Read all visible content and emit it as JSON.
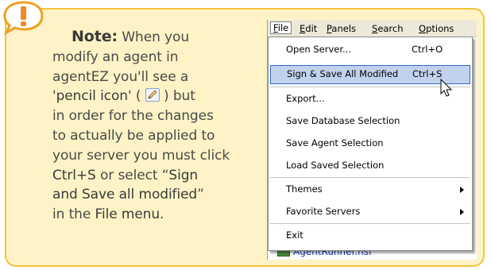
{
  "note": {
    "label": "Note:",
    "line1_rest": " When you",
    "line2": "modify an agent in",
    "line3": "agentEZ you'll see a",
    "line4_pre": "'",
    "pencil_phrase": "pencil icon",
    "line4_mid": "' (",
    "line4_post": ") but",
    "line5": "in order for the changes",
    "line6": "to actually be applied to",
    "line7": "your server you must click",
    "shortcut": "Ctrl+S",
    "line8_mid": " or select “",
    "sign_phrase1": "Sign",
    "sign_phrase2": "and Save all modified",
    "line9_post": "”",
    "line10_pre": "in the ",
    "file_menu": "File menu",
    "line10_post": "."
  },
  "app": {
    "menubar": [
      {
        "label": "File",
        "active": true
      },
      {
        "label": "Edit",
        "active": false
      },
      {
        "label": "Panels",
        "active": false
      },
      {
        "label": "Search",
        "active": false
      },
      {
        "label": "Options",
        "active": false
      }
    ],
    "file_menu_items": [
      {
        "label": "Open Server...",
        "shortcut": "Ctrl+O"
      },
      {
        "label": "Sign & Save All Modified",
        "shortcut": "Ctrl+S",
        "highlighted": true
      },
      {
        "label": "Export..."
      },
      {
        "label": "Save Database Selection"
      },
      {
        "label": "Save Agent Selection"
      },
      {
        "label": "Load Saved Selection"
      },
      {
        "label": "Themes",
        "submenu": true
      },
      {
        "label": "Favorite Servers",
        "submenu": true
      },
      {
        "label": "Exit"
      }
    ],
    "background_row": "AgentRunner.nsf"
  },
  "colors": {
    "note_bg": "#fdf3c6",
    "note_border": "#f3c43a",
    "badge": "#f0a020",
    "highlight_bg": "#c1d2ee",
    "highlight_border": "#316ac5"
  }
}
